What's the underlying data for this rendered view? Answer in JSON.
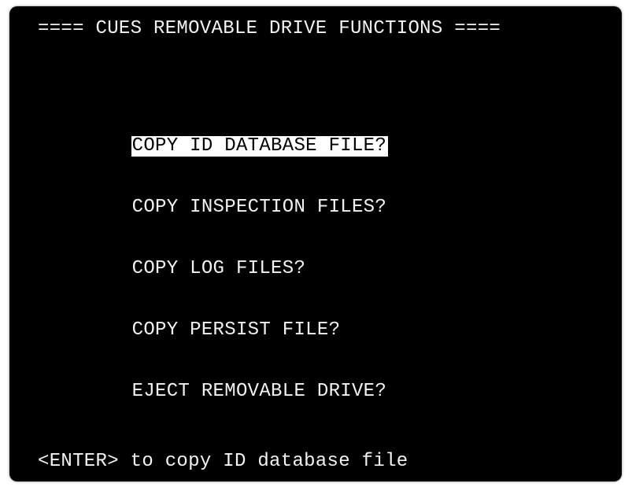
{
  "screen": {
    "title": "==== CUES REMOVABLE DRIVE FUNCTIONS ===="
  },
  "menu": {
    "items": [
      {
        "label": "COPY ID DATABASE FILE?",
        "selected": true
      },
      {
        "label": "COPY INSPECTION FILES?",
        "selected": false
      },
      {
        "label": "COPY LOG FILES?",
        "selected": false
      },
      {
        "label": "COPY PERSIST FILE?",
        "selected": false
      },
      {
        "label": "EJECT REMOVABLE DRIVE?",
        "selected": false
      }
    ]
  },
  "status": {
    "hint": "<ENTER> to copy ID database file"
  },
  "colors": {
    "background": "#000000",
    "text": "#f2f2f2",
    "highlight_bg": "#ffffff",
    "highlight_text": "#000000"
  }
}
